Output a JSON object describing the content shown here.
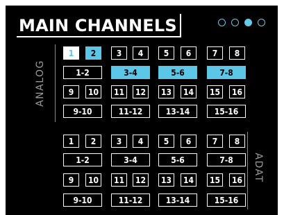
{
  "header": {
    "title": "MAIN CHANNELS",
    "pages": [
      {
        "state": "inactive"
      },
      {
        "state": "inactive"
      },
      {
        "state": "active"
      },
      {
        "state": "inactive"
      }
    ]
  },
  "analog": {
    "label": "ANALOG",
    "mono_row1": [
      {
        "label": "1",
        "state": "current"
      },
      {
        "label": "2",
        "state": "selected"
      },
      {
        "label": "3",
        "state": "off"
      },
      {
        "label": "4",
        "state": "off"
      },
      {
        "label": "5",
        "state": "off"
      },
      {
        "label": "6",
        "state": "off"
      },
      {
        "label": "7",
        "state": "off"
      },
      {
        "label": "8",
        "state": "off"
      }
    ],
    "stereo_row1": [
      {
        "label": "1-2",
        "state": "off"
      },
      {
        "label": "3-4",
        "state": "selected"
      },
      {
        "label": "5-6",
        "state": "selected"
      },
      {
        "label": "7-8",
        "state": "selected"
      }
    ],
    "mono_row2": [
      {
        "label": "9",
        "state": "off"
      },
      {
        "label": "10",
        "state": "off"
      },
      {
        "label": "11",
        "state": "off"
      },
      {
        "label": "12",
        "state": "off"
      },
      {
        "label": "13",
        "state": "off"
      },
      {
        "label": "14",
        "state": "off"
      },
      {
        "label": "15",
        "state": "off"
      },
      {
        "label": "16",
        "state": "off"
      }
    ],
    "stereo_row2": [
      {
        "label": "9-10",
        "state": "off"
      },
      {
        "label": "11-12",
        "state": "off"
      },
      {
        "label": "13-14",
        "state": "off"
      },
      {
        "label": "15-16",
        "state": "off"
      }
    ]
  },
  "adat": {
    "label": "ADAT",
    "mono_row1": [
      {
        "label": "1",
        "state": "off"
      },
      {
        "label": "2",
        "state": "off"
      },
      {
        "label": "3",
        "state": "off"
      },
      {
        "label": "4",
        "state": "off"
      },
      {
        "label": "5",
        "state": "off"
      },
      {
        "label": "6",
        "state": "off"
      },
      {
        "label": "7",
        "state": "off"
      },
      {
        "label": "8",
        "state": "off"
      }
    ],
    "stereo_row1": [
      {
        "label": "1-2",
        "state": "off"
      },
      {
        "label": "3-4",
        "state": "off"
      },
      {
        "label": "5-6",
        "state": "off"
      },
      {
        "label": "7-8",
        "state": "off"
      }
    ],
    "mono_row2": [
      {
        "label": "9",
        "state": "off"
      },
      {
        "label": "10",
        "state": "off"
      },
      {
        "label": "11",
        "state": "off"
      },
      {
        "label": "12",
        "state": "off"
      },
      {
        "label": "13",
        "state": "off"
      },
      {
        "label": "14",
        "state": "off"
      },
      {
        "label": "15",
        "state": "off"
      },
      {
        "label": "16",
        "state": "off"
      }
    ],
    "stereo_row2": [
      {
        "label": "9-10",
        "state": "off"
      },
      {
        "label": "11-12",
        "state": "off"
      },
      {
        "label": "13-14",
        "state": "off"
      },
      {
        "label": "15-16",
        "state": "off"
      }
    ]
  },
  "colors": {
    "background": "#000000",
    "accent": "#5cc6e8",
    "text": "#ffffff",
    "group_label": "#9a9a9a"
  }
}
